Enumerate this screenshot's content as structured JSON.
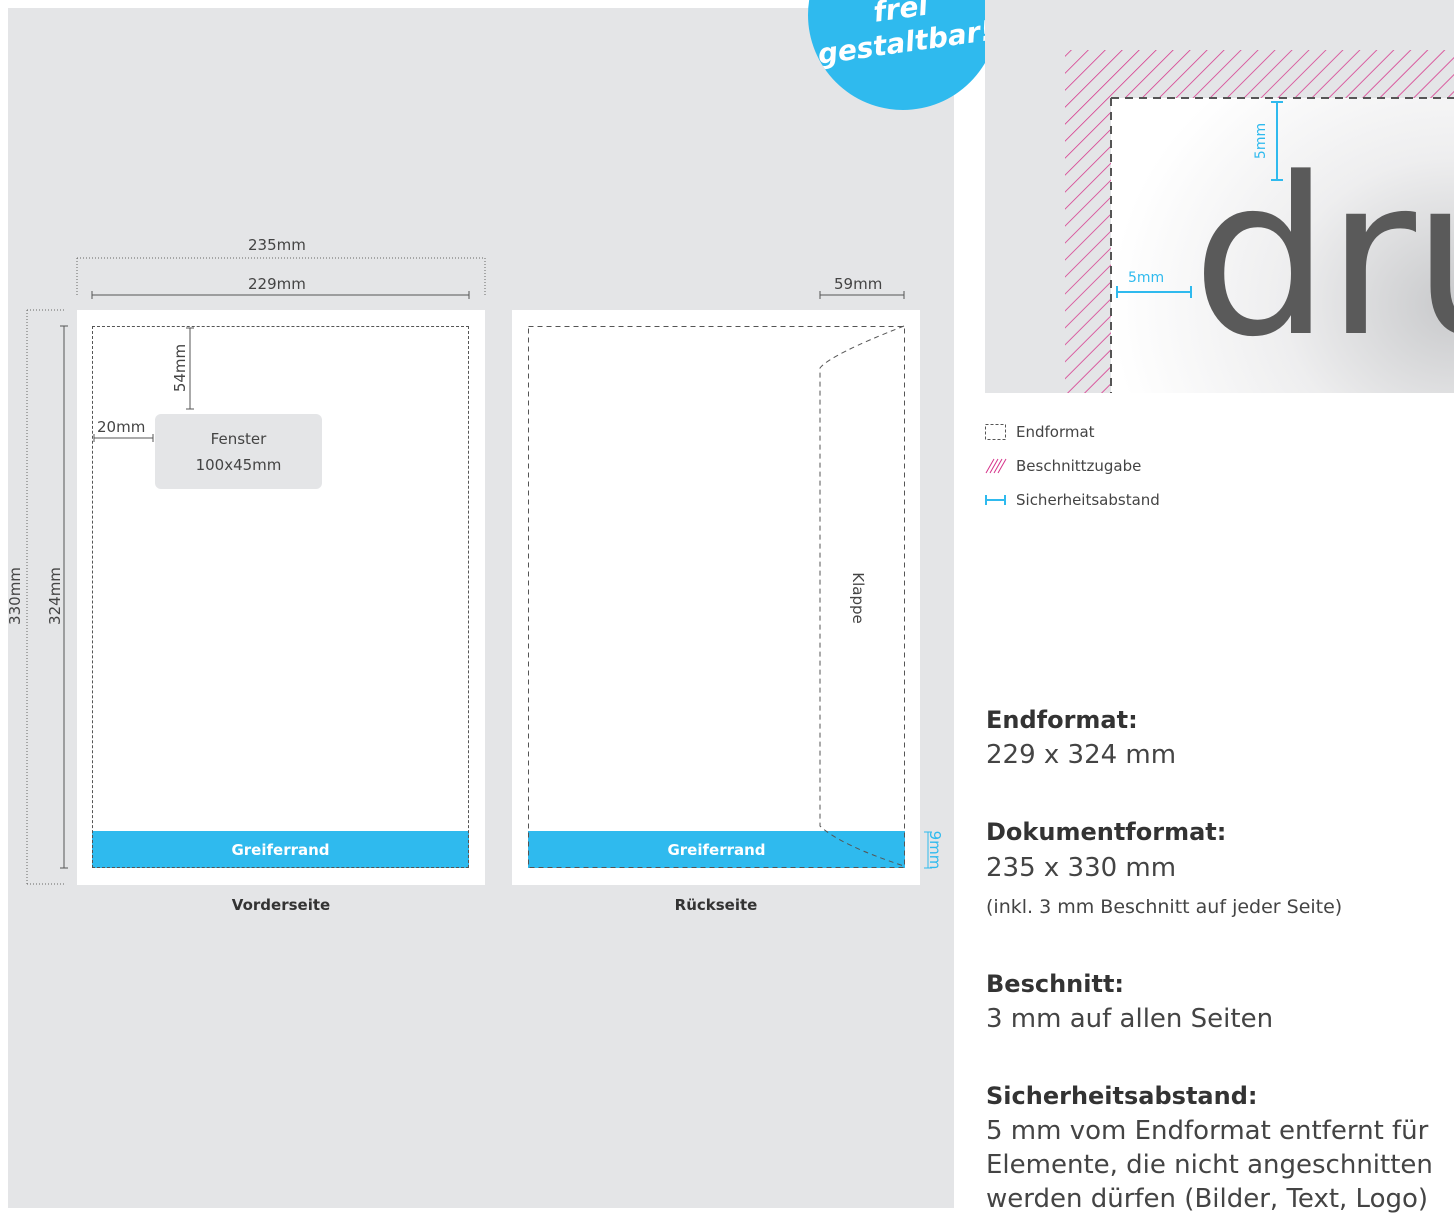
{
  "badge": {
    "line1": "frei",
    "line2": "gestaltbar!"
  },
  "front": {
    "dim_outer_width": "235mm",
    "dim_inner_width": "229mm",
    "dim_outer_height": "330mm",
    "dim_inner_height": "324mm",
    "dim_window_top": "54mm",
    "dim_window_left": "20mm",
    "window_label": "Fenster",
    "window_size": "100x45mm",
    "grip_label": "Greiferrand",
    "caption": "Vorderseite"
  },
  "back": {
    "dim_flap": "59mm",
    "flap_label": "Klappe",
    "grip_label": "Greiferrand",
    "dim_grip": "9mm",
    "caption": "Rückseite"
  },
  "detail": {
    "text": "dru",
    "dim_top": "5mm",
    "dim_left": "5mm"
  },
  "legend": [
    {
      "icon": "dashed-box-icon",
      "label": "Endformat"
    },
    {
      "icon": "hatch-icon",
      "label": "Beschnittzugabe"
    },
    {
      "icon": "safety-margin-icon",
      "label": "Sicherheitsabstand"
    }
  ],
  "info": {
    "endformat_title": "Endformat:",
    "endformat_value": "229 x 324 mm",
    "dokument_title": "Dokumentformat:",
    "dokument_value": "235 x 330 mm",
    "dokument_note": "(inkl. 3 mm Beschnitt auf jeder Seite)",
    "beschnitt_title": "Beschnitt:",
    "beschnitt_value": "3 mm auf allen Seiten",
    "sicherheit_title": "Sicherheitsabstand:",
    "sicherheit_line1": "5 mm vom Endformat entfernt für",
    "sicherheit_line2": "Elemente, die nicht angeschnitten",
    "sicherheit_line3": "werden dürfen (Bilder, Text, Logo)"
  },
  "colors": {
    "accent": "#2fbaee",
    "bleed": "#d6338a",
    "panel": "#e4e5e7"
  }
}
